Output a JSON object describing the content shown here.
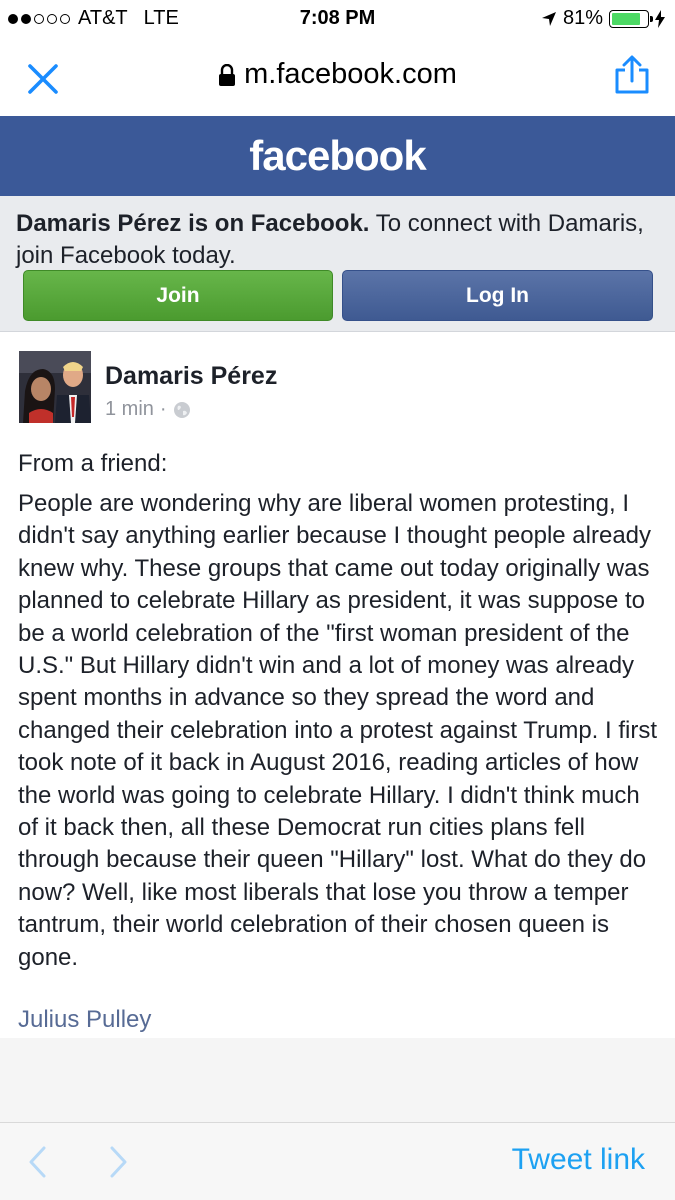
{
  "status_bar": {
    "carrier": "AT&T",
    "network": "LTE",
    "time": "7:08 PM",
    "battery_percent": "81%",
    "battery_level": 0.81,
    "signal_bars_filled": 2,
    "signal_bars_total": 5
  },
  "browser": {
    "url": "m.facebook.com",
    "lock_icon": "lock-icon",
    "close_icon": "close-icon",
    "share_icon": "share-icon",
    "accent_color": "#1a8cff"
  },
  "header": {
    "logo": "facebook",
    "background": "#3b5998"
  },
  "join_banner": {
    "bold_text": "Damaris Pérez is on Facebook.",
    "text": " To connect with Damaris, join Facebook today.",
    "join_label": "Join",
    "login_label": "Log In"
  },
  "post": {
    "author": "Damaris Pérez",
    "time": "1 min",
    "separator": "·",
    "audience_icon": "globe-icon",
    "lead": "From a friend:",
    "body": "People are wondering why are liberal women protesting, I didn't say anything earlier because I thought people already knew why. These groups that came out today originally was planned to celebrate Hillary as president, it was suppose to be a world celebration of the \"first woman president of the U.S.\" But Hillary didn't win and a lot of money was already spent months in advance so they spread the word and changed their celebration into a protest against Trump. I first took note of it back in August 2016, reading articles of how the world was going to celebrate Hillary. I didn't think much of it back then, all these Democrat run cities plans fell through because their queen \"Hillary\" lost. What do they do now? Well, like most liberals that lose you throw a temper tantrum, their world celebration of their chosen queen is gone.",
    "link": "Julius Pulley"
  },
  "toolbar": {
    "tweet_link": "Tweet link",
    "back_icon": "chevron-left-icon",
    "forward_icon": "chevron-right-icon"
  }
}
